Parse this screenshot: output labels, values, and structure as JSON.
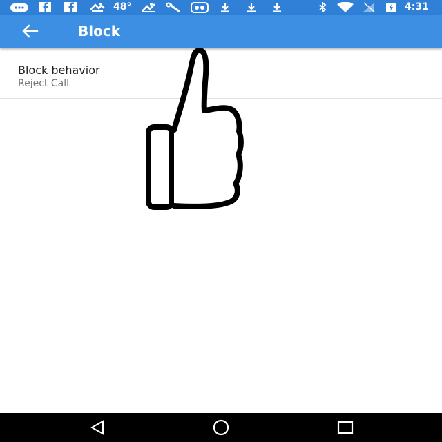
{
  "status_bar": {
    "temperature": "48°",
    "time": "4:31",
    "icons": [
      "messaging-icon",
      "facebook-icon",
      "facebook-icon",
      "weather-icon",
      "temperature",
      "cleaner-icon",
      "wrench-icon",
      "gallery-icon",
      "download-icon",
      "download-icon",
      "download-icon",
      "bluetooth-icon",
      "wifi-icon",
      "no-signal-icon",
      "battery-charging-icon",
      "time"
    ]
  },
  "app_bar": {
    "back_icon": "arrow-back-icon",
    "title": "Block"
  },
  "settings": {
    "items": [
      {
        "title": "Block behavior",
        "summary": "Reject Call"
      }
    ]
  },
  "overlay": {
    "icon": "thumbs-up-icon"
  },
  "nav_bar": {
    "icons": [
      "back-triangle-icon",
      "home-circle-icon",
      "recents-square-icon"
    ]
  },
  "colors": {
    "status_bar": "#2f80d6",
    "app_bar": "#3c8fe2",
    "nav_bar": "#000000"
  }
}
